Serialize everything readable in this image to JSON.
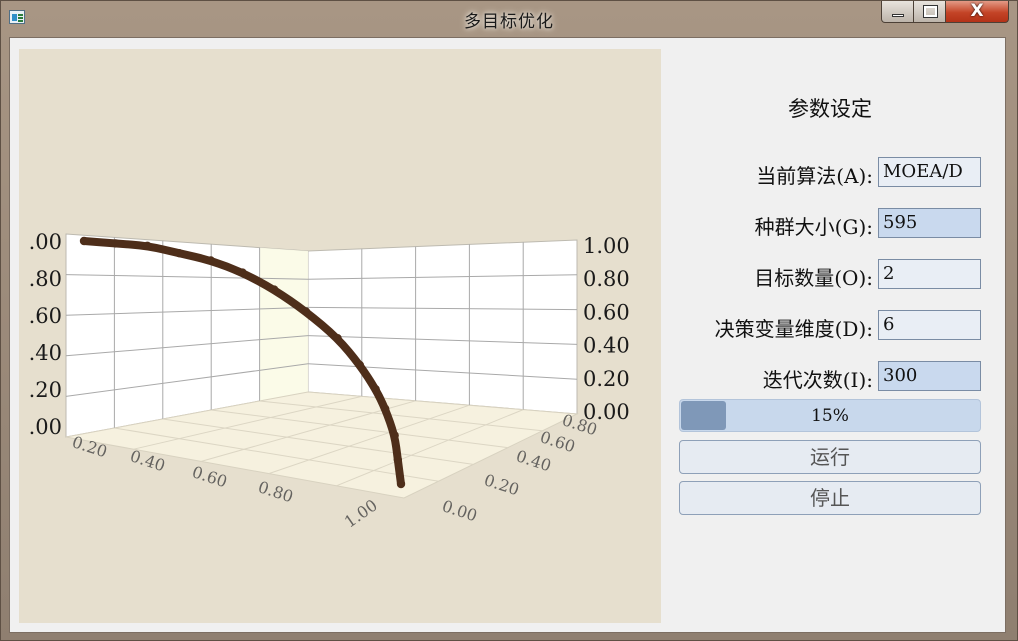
{
  "window": {
    "title": "多目标优化",
    "close_label": "X"
  },
  "panel": {
    "title": "参数设定",
    "algorithm": {
      "label": "当前算法(A):",
      "value": "MOEA/D"
    },
    "population": {
      "label": "种群大小(G):",
      "value": "595"
    },
    "objectives": {
      "label": "目标数量(O):",
      "value": "2"
    },
    "dimension": {
      "label": "决策变量维度(D):",
      "value": "6"
    },
    "iterations": {
      "label": "迭代次数(I):",
      "value": "300"
    },
    "progress": {
      "text": "15%",
      "fraction": 0.15
    },
    "run_label": "运行",
    "stop_label": "停止"
  },
  "chart_data": {
    "type": "scatter",
    "projection": "3d",
    "background_color": "#e6dfce",
    "point_color": "#4e2e1a",
    "grid": true,
    "left_axis_ticks": [
      ".00",
      ".80",
      ".60",
      ".40",
      ".20",
      ".00"
    ],
    "right_axis_ticks": [
      "1.00",
      "0.80",
      "0.60",
      "0.40",
      "0.20",
      "0.00"
    ],
    "front_axis_ticks": [
      "0.20",
      "0.40",
      "0.60",
      "0.80",
      "1.00"
    ],
    "depth_axis_ticks": [
      "0.00",
      "0.20",
      "0.40",
      "0.60",
      "0.80"
    ],
    "x_range": [
      0,
      1
    ],
    "y_range": [
      0,
      1
    ],
    "series": [
      {
        "points": [
          {
            "x": 0.0,
            "y": 1.0
          },
          {
            "x": 0.1,
            "y": 0.99
          },
          {
            "x": 0.2,
            "y": 0.98
          },
          {
            "x": 0.3,
            "y": 0.95
          },
          {
            "x": 0.4,
            "y": 0.92
          },
          {
            "x": 0.5,
            "y": 0.87
          },
          {
            "x": 0.6,
            "y": 0.8
          },
          {
            "x": 0.7,
            "y": 0.71
          },
          {
            "x": 0.8,
            "y": 0.6
          },
          {
            "x": 0.87,
            "y": 0.49
          },
          {
            "x": 0.92,
            "y": 0.39
          },
          {
            "x": 0.95,
            "y": 0.31
          },
          {
            "x": 0.98,
            "y": 0.2
          },
          {
            "x": 0.99,
            "y": 0.1
          },
          {
            "x": 1.0,
            "y": 0.0
          }
        ]
      }
    ]
  }
}
